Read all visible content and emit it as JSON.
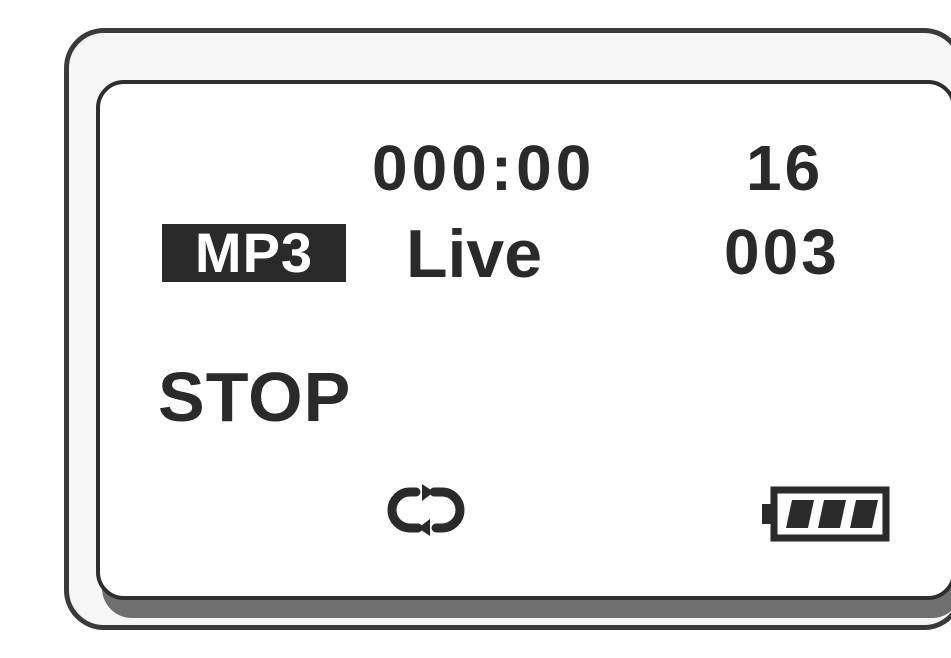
{
  "display": {
    "time": "000:00",
    "track_count": "16",
    "codec": "MP3",
    "folder": "Live",
    "track_number": "003",
    "status": "STOP"
  },
  "icons": {
    "repeat": "repeat-icon",
    "battery": "battery-full-icon"
  },
  "battery_level": 1.0,
  "colors": {
    "lcd_ink": "#2a2a2a",
    "lcd_background": "#ffffff",
    "bezel_shadow": "#6f6f6f"
  }
}
